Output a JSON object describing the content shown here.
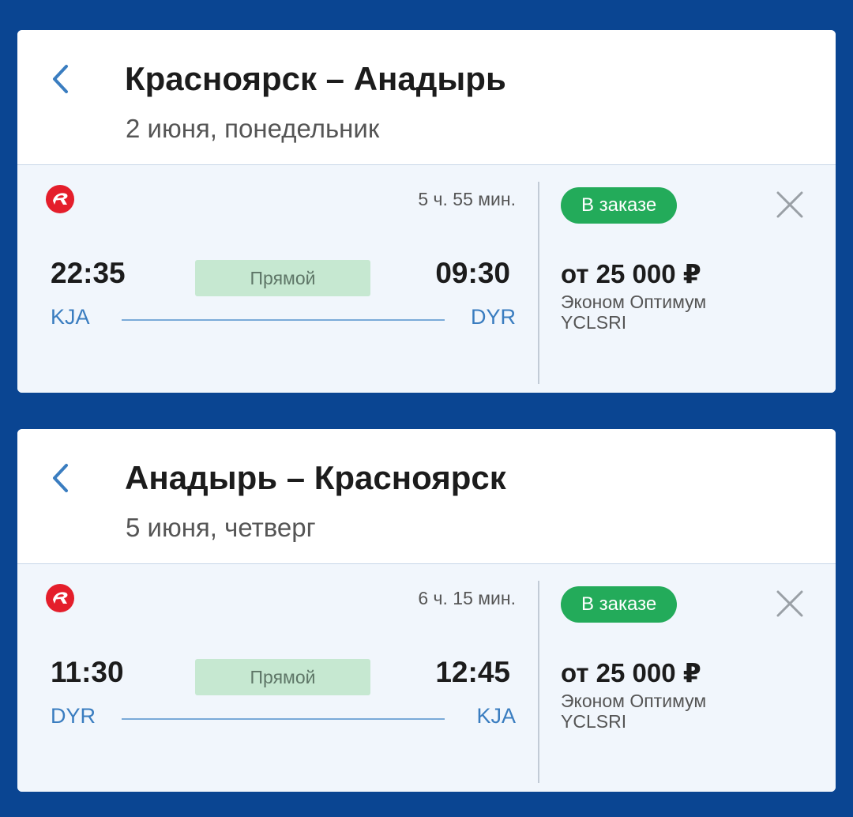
{
  "colors": {
    "background": "#0a4592",
    "accent_blue": "#3a7dc0",
    "status_green": "#23ab5a",
    "direct_badge_bg": "#c6e8d1",
    "airline_logo_red": "#e41e2b"
  },
  "icons": {
    "back": "chevron-left-icon",
    "close": "close-icon",
    "airline": "airline-logo-icon"
  },
  "segments": [
    {
      "title": "Красноярск – Анадырь",
      "date": "2 июня, понедельник",
      "flight": {
        "duration": "5 ч. 55 мин.",
        "departure_time": "22:35",
        "arrival_time": "09:30",
        "transfer_label": "Прямой",
        "origin_code": "KJA",
        "destination_code": "DYR",
        "status": "В заказе",
        "price": "от 25 000 ₽",
        "fare_class": "Эконом Оптимум",
        "fare_code": "YCLSRI"
      }
    },
    {
      "title": "Анадырь – Красноярск",
      "date": "5 июня, четверг",
      "flight": {
        "duration": "6 ч. 15 мин.",
        "departure_time": "11:30",
        "arrival_time": "12:45",
        "transfer_label": "Прямой",
        "origin_code": "DYR",
        "destination_code": "KJA",
        "status": "В заказе",
        "price": "от 25 000 ₽",
        "fare_class": "Эконом Оптимум",
        "fare_code": "YCLSRI"
      }
    }
  ]
}
